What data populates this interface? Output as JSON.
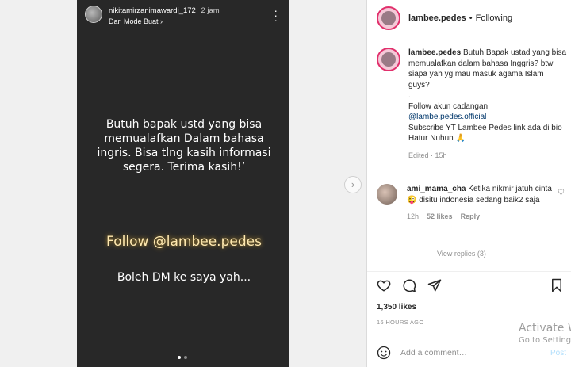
{
  "story": {
    "username": "nikitamirzanimawardi_172",
    "time": "2 jam",
    "source": "Dari Mode Buat",
    "main_text": "Butuh bapak ustd yang bisa memualafkan Dalam bahasa ingris. Bisa tlng kasih informasi segera. Terima kasih!’",
    "follow_text": "Follow @lambee.pedes",
    "dm_text": "Boleh DM ke saya yah..."
  },
  "post": {
    "username": "lambee.pedes",
    "following_label": "Following",
    "caption": {
      "username": "lambee.pedes",
      "line1": "Butuh Bapak ustad yang bisa memualafkan dalam bahasa Inggris? btw siapa yah yg mau masuk agama Islam guys?",
      "dot": ".",
      "line2": "Follow akun cadangan",
      "link": "@lambe.pedes.official",
      "line3": "Subscribe YT Lambee Pedes link ada di bio Hatur Nuhun 🙏",
      "edited": "Edited · 15h"
    },
    "comment": {
      "username": "ami_mama_cha",
      "text": "Ketika nikmir jatuh cinta😜 disitu indonesia sedang baik2 saja",
      "time": "12h",
      "likes": "52 likes",
      "reply": "Reply",
      "view_replies": "View replies (3)"
    },
    "likes_count": "1,350 likes",
    "time_ago": "16 HOURS AGO",
    "add_comment_placeholder": "Add a comment…",
    "post_label": "Post"
  },
  "watermark": {
    "line1": "Activate W",
    "line2": "Go to Setting"
  }
}
